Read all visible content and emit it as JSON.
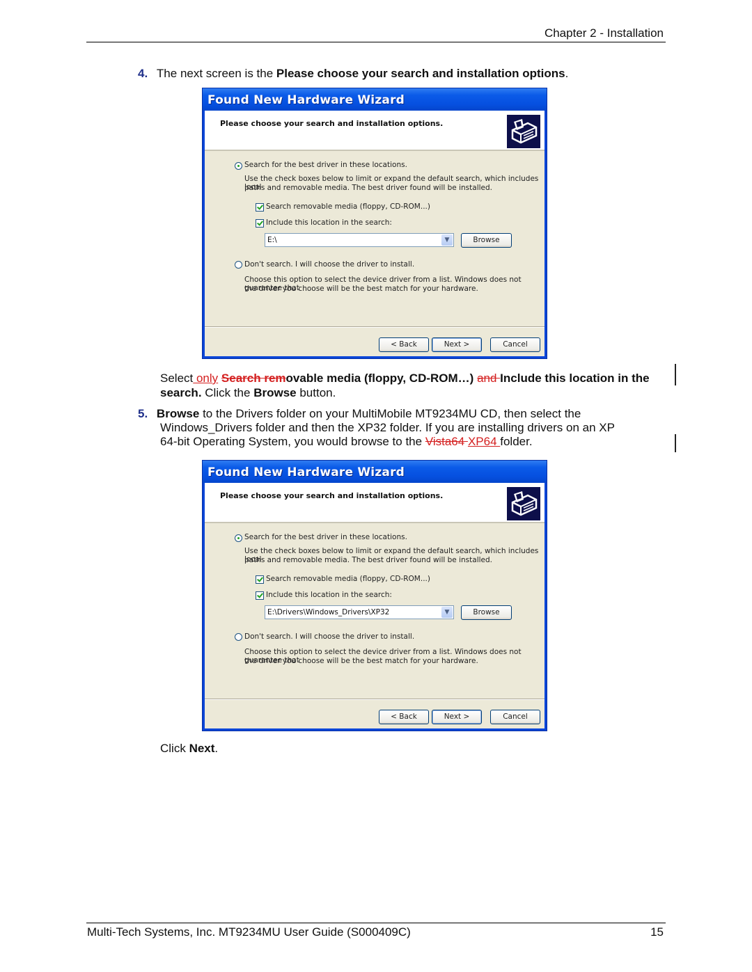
{
  "header": {
    "chapter": "Chapter 2 - Installation"
  },
  "step4": {
    "number": "4.",
    "text_prefix": "The next screen is the ",
    "text_bold": "Please choose your search and installation options",
    "text_suffix": "."
  },
  "dialogs": [
    {
      "title": "Found New Hardware Wizard",
      "heading": "Please choose your search and installation options.",
      "icon": "hardware-icon",
      "option1_label": "Search for the best driver in these locations.",
      "option1_selected": true,
      "option1_desc_line1": "Use the check boxes below to limit or expand the default search, which includes local",
      "option1_desc_line2": "paths and removable media. The best driver found will be installed.",
      "check1_label": "Search removable media (floppy, CD-ROM...)",
      "check1_checked": true,
      "check2_label": "Include this location in the search:",
      "check2_checked": true,
      "location_value": "E:\\",
      "browse_label": "Browse",
      "option2_label": "Don't search. I will choose the driver to install.",
      "option2_selected": false,
      "option2_desc_line1": "Choose this option to select the device driver from a list.  Windows does not guarantee that",
      "option2_desc_line2": "the driver you choose will be the best match for your hardware.",
      "back_label": "< Back",
      "next_label": "Next >",
      "cancel_label": "Cancel"
    },
    {
      "title": "Found New Hardware Wizard",
      "heading": "Please choose your search and installation options.",
      "icon": "hardware-icon",
      "option1_label": "Search for the best driver in these locations.",
      "option1_selected": true,
      "option1_desc_line1": "Use the check boxes below to limit or expand the default search, which includes local",
      "option1_desc_line2": "paths and removable media. The best driver found will be installed.",
      "check1_label": "Search removable media (floppy, CD-ROM...)",
      "check1_checked": true,
      "check2_label": "Include this location in the search:",
      "check2_checked": true,
      "location_value": "E:\\Drivers\\Windows_Drivers\\XP32",
      "browse_label": "Browse",
      "option2_label": "Don't search. I will choose the driver to install.",
      "option2_selected": false,
      "option2_desc_line1": "Choose this option to select the device driver from a list.  Windows does not guarantee that",
      "option2_desc_line2": "the driver you choose will be the best match for your hardware.",
      "back_label": "< Back",
      "next_label": "Next >",
      "cancel_label": "Cancel"
    }
  ],
  "select_para": {
    "t1": "Select",
    "ins1": " only",
    "t2": " ",
    "del1": "Search rem",
    "b1": "ovable media (floppy, CD-ROM…)",
    "t3": " ",
    "del2": "and ",
    "b2": "Include this location in the search.",
    "t4": "  Click the ",
    "b3": "Browse",
    "t5": " button."
  },
  "step5": {
    "number": "5.",
    "b1": "Browse",
    "t1": " to the Drivers folder on your MultiMobile MT9234MU CD, then select the",
    "t2": "Windows_Drivers folder and then the XP32 folder. If you are installing drivers on an XP",
    "t3": "64-bit Operating System, you would browse to the ",
    "del1": "Vista64 ",
    "ins1": "XP64 ",
    "t4": "folder."
  },
  "click_next": {
    "t1": "Click ",
    "b1": "Next",
    "t2": "."
  },
  "footer": {
    "left": "Multi-Tech Systems, Inc. MT9234MU User Guide (S000409C)",
    "page": "15"
  },
  "colors": {
    "revision_red": "#d42020",
    "step_number_blue": "#1f2f8a",
    "xp_title_blue": "#0b5be8"
  }
}
